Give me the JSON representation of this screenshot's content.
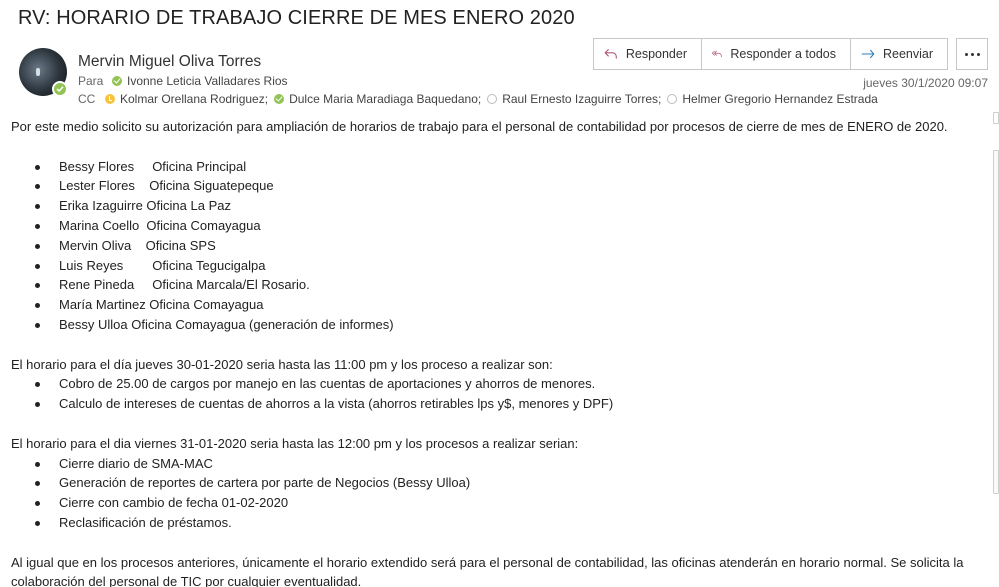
{
  "subject": "RV: HORARIO DE TRABAJO CIERRE DE MES ENERO 2020",
  "sender": {
    "name": "Mervin Miguel Oliva Torres",
    "presence": "available"
  },
  "to": {
    "label": "Para",
    "recipients": [
      {
        "name": "Ivonne Leticia Valladares Rios",
        "status": "available"
      }
    ]
  },
  "cc": {
    "label": "CC",
    "recipients": [
      {
        "name": "Kolmar Orellana Rodriguez;",
        "status": "away"
      },
      {
        "name": "Dulce Maria Maradiaga Baquedano;",
        "status": "available"
      },
      {
        "name": "Raul Ernesto Izaguirre Torres;",
        "status": "offline"
      },
      {
        "name": "Helmer Gregorio Hernandez Estrada",
        "status": "offline"
      }
    ]
  },
  "actions": {
    "reply": "Responder",
    "reply_all": "Responder a todos",
    "forward": "Reenviar",
    "reply_icon": "reply-arrow-icon",
    "reply_all_icon": "reply-all-arrow-icon",
    "forward_icon": "forward-arrow-icon",
    "more_icon": "more-ellipsis-icon",
    "accent": "#b0527a",
    "forward_color": "#2f7fb5"
  },
  "date": "jueves 30/1/2020 09:07",
  "body": {
    "intro": "Por este medio solicito su autorización para ampliación de horarios de trabajo para el personal de contabilidad por procesos de cierre de mes de ENERO de 2020.",
    "staff": [
      "Bessy Flores     Oficina Principal",
      "Lester Flores    Oficina Siguatepeque",
      "Erika Izaguirre Oficina La Paz",
      "Marina Coello  Oficina Comayagua",
      "Mervin Oliva    Oficina SPS",
      "Luis Reyes        Oficina Tegucigalpa",
      "Rene Pineda     Oficina Marcala/El Rosario.",
      "María Martinez Oficina Comayagua",
      "Bessy Ulloa Oficina Comayagua (generación de informes)"
    ],
    "thursday_intro": "El horario para el día jueves 30-01-2020 seria hasta las 11:00 pm y los proceso a realizar son:",
    "thursday_tasks": [
      "Cobro de 25.00 de cargos por manejo en las cuentas de aportaciones y ahorros de menores.",
      "Calculo de intereses de cuentas de ahorros a la vista (ahorros retirables lps y$, menores y DPF)"
    ],
    "friday_intro": "El horario para el dia viernes 31-01-2020 seria hasta las 12:00 pm y los procesos a realizar serian:",
    "friday_tasks": [
      "Cierre diario de SMA-MAC",
      "Generación de reportes de cartera por parte de Negocios (Bessy Ulloa)",
      "Cierre con cambio de fecha 01-02-2020",
      "Reclasificación de préstamos."
    ],
    "closing": "Al igual que en los procesos anteriores, únicamente el horario extendido será para el personal de contabilidad, las oficinas atenderán en horario normal. Se solicita la colaboración del personal de TIC por cualquier eventualidad."
  }
}
